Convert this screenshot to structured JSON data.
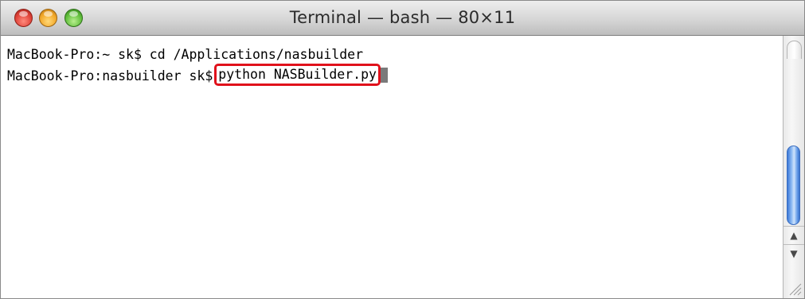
{
  "window": {
    "title": "Terminal — bash — 80×11"
  },
  "terminal": {
    "line1": "MacBook-Pro:~ sk$ cd /Applications/nasbuilder",
    "line2_prompt": "MacBook-Pro:nasbuilder sk$",
    "line2_command": "python NASBuilder.py"
  },
  "scrollbar": {
    "up_arrow": "▲",
    "down_arrow": "▼"
  },
  "icons": {
    "close": "close-button-icon",
    "minimize": "minimize-button-icon",
    "zoom": "zoom-button-icon",
    "resize": "resize-grip-icon"
  },
  "colors": {
    "highlight": "#e0111b",
    "scroll_thumb": "#5b93e3"
  }
}
